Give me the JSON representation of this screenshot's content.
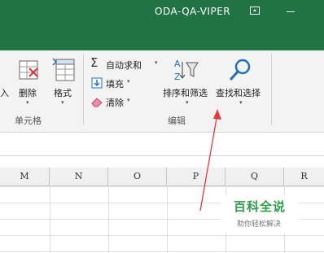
{
  "titlebar": {
    "title": "ODA-QA-VIPER"
  },
  "cells_group": {
    "partial_label": "入",
    "delete_label": "删除",
    "format_label": "格式",
    "group_label": "单元格"
  },
  "edit_group": {
    "autosum_label": "自动求和",
    "fill_label": "填充",
    "clear_label": "清除",
    "sort_filter_label": "排序和筛选",
    "find_select_label": "查找和选择",
    "group_label": "编辑"
  },
  "columns": [
    "M",
    "N",
    "O",
    "P",
    "Q",
    "R"
  ],
  "watermark": {
    "main": "百科全说",
    "sub": "助你轻松解决"
  },
  "colors": {
    "accent": "#217346",
    "arrow": "#e0393e",
    "watermark": "#2e9d4a"
  }
}
